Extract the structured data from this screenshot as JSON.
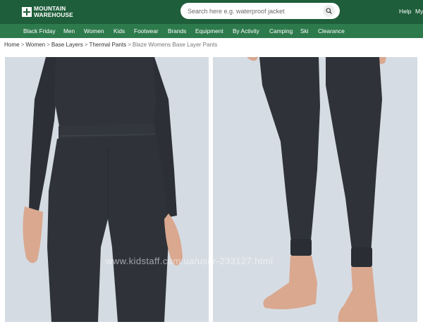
{
  "header": {
    "brand_line1": "MOUNTAIN",
    "brand_line2": "WAREHOUSE",
    "search_placeholder": "Search here e.g. waterproof jacket",
    "help_label": "Help",
    "account_label": "My"
  },
  "nav": {
    "items": [
      "Black Friday",
      "Men",
      "Women",
      "Kids",
      "Footwear",
      "Brands",
      "Equipment",
      "By Activity",
      "Camping",
      "Ski",
      "Clearance"
    ]
  },
  "breadcrumb": {
    "items": [
      "Home",
      "Women",
      "Base Layers",
      "Thermal Pants"
    ],
    "separator": ">",
    "current": "Blaze Womens Base Layer Pants"
  },
  "watermark": "www.kidstaff.com.ua/user-233127.html",
  "colors": {
    "header_bg": "#1e5e3a",
    "nav_bg": "#2d7a4c",
    "photo_bg": "#d6dce4",
    "garment": "#2f3339"
  },
  "icons": [
    "logo-mark-icon",
    "search-icon"
  ]
}
